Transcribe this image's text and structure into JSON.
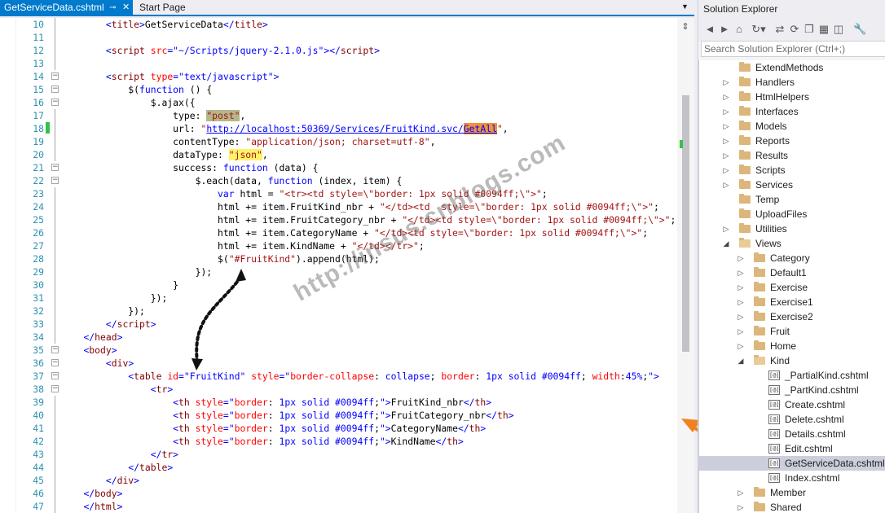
{
  "tabs": {
    "active": "GetServiceData.cshtml",
    "active_pin": "⊸",
    "active_close": "✕",
    "second": "Start Page",
    "dropdown": "▼"
  },
  "code_lines": [
    {
      "n": "10",
      "h": "        <span class=\"k\">&lt;</span><span class=\"t\">title</span><span class=\"k\">&gt;</span>GetServiceData<span class=\"k\">&lt;/</span><span class=\"t\">title</span><span class=\"k\">&gt;</span>"
    },
    {
      "n": "11",
      "h": ""
    },
    {
      "n": "12",
      "h": "        <span class=\"k\">&lt;</span><span class=\"t\">script</span> <span class=\"a\">src</span><span class=\"k\">=\"~/Scripts/jquery-2.1.0.js\"&gt;&lt;/</span><span class=\"t\">script</span><span class=\"k\">&gt;</span>"
    },
    {
      "n": "13",
      "h": ""
    },
    {
      "n": "14",
      "h": "        <span class=\"k\">&lt;</span><span class=\"t\">script</span> <span class=\"a\">type</span><span class=\"k\">=\"text/javascript\"&gt;</span>"
    },
    {
      "n": "15",
      "h": "            $(<span class=\"k\">function</span> () {"
    },
    {
      "n": "16",
      "h": "                $.ajax({"
    },
    {
      "n": "17",
      "h": "                    type: <span class=\"s hl-olive\">\"post\"</span>,"
    },
    {
      "n": "18",
      "h": "                    url: <span class=\"s\">\"</span><span class=\"u\">http://localhost:50369/Services/FruitKind.svc/</span><span class=\"u hl-orange\">GetAll</span><span class=\"s\">\"</span>,"
    },
    {
      "n": "19",
      "h": "                    contentType: <span class=\"s\">\"application/json; charset=utf-8\"</span>,"
    },
    {
      "n": "20",
      "h": "                    dataType: <span class=\"s hl-yellow\">\"json\"</span>,"
    },
    {
      "n": "21",
      "h": "                    success: <span class=\"k\">function</span> (data) {"
    },
    {
      "n": "22",
      "h": "                        $.each(data, <span class=\"k\">function</span> (index, item) {"
    },
    {
      "n": "23",
      "h": "                            <span class=\"k\">var</span> html = <span class=\"s\">\"&lt;tr&gt;&lt;td style=\\\"border: 1px solid #0094ff;\\\"&gt;\"</span>;"
    },
    {
      "n": "24",
      "h": "                            html += item.FruitKind_nbr + <span class=\"s\">\"&lt;/td&gt;&lt;td  style=\\\"border: 1px solid #0094ff;\\\"&gt;\"</span>;"
    },
    {
      "n": "25",
      "h": "                            html += item.FruitCategory_nbr + <span class=\"s\">\"&lt;/td&gt;&lt;td style=\\\"border: 1px solid #0094ff;\\\"&gt;\"</span>;"
    },
    {
      "n": "26",
      "h": "                            html += item.CategoryName + <span class=\"s\">\"&lt;/td&gt;&lt;td style=\\\"border: 1px solid #0094ff;\\\"&gt;\"</span>;"
    },
    {
      "n": "27",
      "h": "                            html += item.KindName + <span class=\"s\">\"&lt;/td&gt;&lt;/tr&gt;\"</span>;"
    },
    {
      "n": "28",
      "h": "                            $(<span class=\"s\">\"#FruitKind\"</span>).append(html);"
    },
    {
      "n": "29",
      "h": "                        });"
    },
    {
      "n": "30",
      "h": "                    }"
    },
    {
      "n": "31",
      "h": "                });"
    },
    {
      "n": "32",
      "h": "            });"
    },
    {
      "n": "33",
      "h": "        <span class=\"k\">&lt;/</span><span class=\"t\">script</span><span class=\"k\">&gt;</span>"
    },
    {
      "n": "34",
      "h": "    <span class=\"k\">&lt;/</span><span class=\"t\">head</span><span class=\"k\">&gt;</span>"
    },
    {
      "n": "35",
      "h": "    <span class=\"k\">&lt;</span><span class=\"t\">body</span><span class=\"k\">&gt;</span>"
    },
    {
      "n": "36",
      "h": "        <span class=\"k\">&lt;</span><span class=\"t\">div</span><span class=\"k\">&gt;</span>"
    },
    {
      "n": "37",
      "h": "            <span class=\"k\">&lt;</span><span class=\"t\">table</span> <span class=\"a\">id</span><span class=\"k\">=\"FruitKind\"</span> <span class=\"a\">style</span><span class=\"k\">=\"</span><span class=\"a\">border-collapse</span>: <span class=\"hs\">collapse</span>; <span class=\"a\">border</span>: <span class=\"hs\">1px solid #0094ff</span>; <span class=\"a\">width</span>:<span class=\"hs\">45%</span>;<span class=\"k\">\"&gt;</span>"
    },
    {
      "n": "38",
      "h": "                <span class=\"k\">&lt;</span><span class=\"t\">tr</span><span class=\"k\">&gt;</span>"
    },
    {
      "n": "39",
      "h": "                    <span class=\"k\">&lt;</span><span class=\"t\">th</span> <span class=\"a\">style</span><span class=\"k\">=\"</span><span class=\"a\">border</span>: <span class=\"hs\">1px solid #0094ff</span>;<span class=\"k\">\"&gt;</span>FruitKind_nbr<span class=\"k\">&lt;/</span><span class=\"t\">th</span><span class=\"k\">&gt;</span>"
    },
    {
      "n": "40",
      "h": "                    <span class=\"k\">&lt;</span><span class=\"t\">th</span> <span class=\"a\">style</span><span class=\"k\">=\"</span><span class=\"a\">border</span>: <span class=\"hs\">1px solid #0094ff</span>;<span class=\"k\">\"&gt;</span>FruitCategory_nbr<span class=\"k\">&lt;/</span><span class=\"t\">th</span><span class=\"k\">&gt;</span>"
    },
    {
      "n": "41",
      "h": "                    <span class=\"k\">&lt;</span><span class=\"t\">th</span> <span class=\"a\">style</span><span class=\"k\">=\"</span><span class=\"a\">border</span>: <span class=\"hs\">1px solid #0094ff</span>;<span class=\"k\">\"&gt;</span>CategoryName<span class=\"k\">&lt;/</span><span class=\"t\">th</span><span class=\"k\">&gt;</span>"
    },
    {
      "n": "42",
      "h": "                    <span class=\"k\">&lt;</span><span class=\"t\">th</span> <span class=\"a\">style</span><span class=\"k\">=\"</span><span class=\"a\">border</span>: <span class=\"hs\">1px solid #0094ff</span>;<span class=\"k\">\"&gt;</span>KindName<span class=\"k\">&lt;/</span><span class=\"t\">th</span><span class=\"k\">&gt;</span>"
    },
    {
      "n": "43",
      "h": "                <span class=\"k\">&lt;/</span><span class=\"t\">tr</span><span class=\"k\">&gt;</span>"
    },
    {
      "n": "44",
      "h": "            <span class=\"k\">&lt;/</span><span class=\"t\">table</span><span class=\"k\">&gt;</span>"
    },
    {
      "n": "45",
      "h": "        <span class=\"k\">&lt;/</span><span class=\"t\">div</span><span class=\"k\">&gt;</span>"
    },
    {
      "n": "46",
      "h": "    <span class=\"k\">&lt;/</span><span class=\"t\">body</span><span class=\"k\">&gt;</span>"
    },
    {
      "n": "47",
      "h": "    <span class=\"k\">&lt;/</span><span class=\"t\">html</span><span class=\"k\">&gt;</span>"
    }
  ],
  "watermark": "http://insus.cnblogs.com",
  "solution_explorer": {
    "title": "Solution Explorer",
    "search_placeholder": "Search Solution Explorer (Ctrl+;)",
    "toolbar_icons": [
      "back-icon",
      "forward-icon",
      "home-icon",
      "sync-icon",
      "refresh-icon",
      "collapse-all-icon",
      "show-all-files-icon",
      "properties-icon",
      "wrench-icon"
    ],
    "tree": [
      {
        "label": "ExtendMethods",
        "type": "folder",
        "arrow": ""
      },
      {
        "label": "Handlers",
        "type": "folder",
        "arrow": "▷"
      },
      {
        "label": "HtmlHelpers",
        "type": "folder",
        "arrow": "▷"
      },
      {
        "label": "Interfaces",
        "type": "folder",
        "arrow": "▷"
      },
      {
        "label": "Models",
        "type": "folder",
        "arrow": "▷"
      },
      {
        "label": "Reports",
        "type": "folder",
        "arrow": "▷"
      },
      {
        "label": "Results",
        "type": "folder",
        "arrow": "▷"
      },
      {
        "label": "Scripts",
        "type": "folder",
        "arrow": "▷"
      },
      {
        "label": "Services",
        "type": "folder",
        "arrow": "▷"
      },
      {
        "label": "Temp",
        "type": "folder",
        "arrow": ""
      },
      {
        "label": "UploadFiles",
        "type": "folder",
        "arrow": ""
      },
      {
        "label": "Utilities",
        "type": "folder",
        "arrow": "▷"
      },
      {
        "label": "Views",
        "type": "folder-open",
        "arrow": "◢"
      },
      {
        "label": "Category",
        "type": "folder",
        "arrow": "▷"
      },
      {
        "label": "Default1",
        "type": "folder",
        "arrow": "▷"
      },
      {
        "label": "Exercise",
        "type": "folder",
        "arrow": "▷"
      },
      {
        "label": "Exercise1",
        "type": "folder",
        "arrow": "▷"
      },
      {
        "label": "Exercise2",
        "type": "folder",
        "arrow": "▷"
      },
      {
        "label": "Fruit",
        "type": "folder",
        "arrow": "▷"
      },
      {
        "label": "Home",
        "type": "folder",
        "arrow": "▷"
      },
      {
        "label": "Kind",
        "type": "folder-open",
        "arrow": "◢"
      },
      {
        "label": "_PartialKind.cshtml",
        "type": "file",
        "arrow": ""
      },
      {
        "label": "_PartKind.cshtml",
        "type": "file",
        "arrow": ""
      },
      {
        "label": "Create.cshtml",
        "type": "file",
        "arrow": ""
      },
      {
        "label": "Delete.cshtml",
        "type": "file",
        "arrow": ""
      },
      {
        "label": "Details.cshtml",
        "type": "file",
        "arrow": ""
      },
      {
        "label": "Edit.cshtml",
        "type": "file",
        "arrow": ""
      },
      {
        "label": "GetServiceData.cshtml",
        "type": "file",
        "arrow": "",
        "selected": true
      },
      {
        "label": "Index.cshtml",
        "type": "file",
        "arrow": ""
      },
      {
        "label": "Member",
        "type": "folder",
        "arrow": "▷"
      },
      {
        "label": "Shared",
        "type": "folder",
        "arrow": "▷"
      }
    ]
  },
  "colors": {
    "accent": "#007acc",
    "selection": "#cccedb",
    "orange_arrow": "#f0821e",
    "change_marker": "#35c14b"
  }
}
